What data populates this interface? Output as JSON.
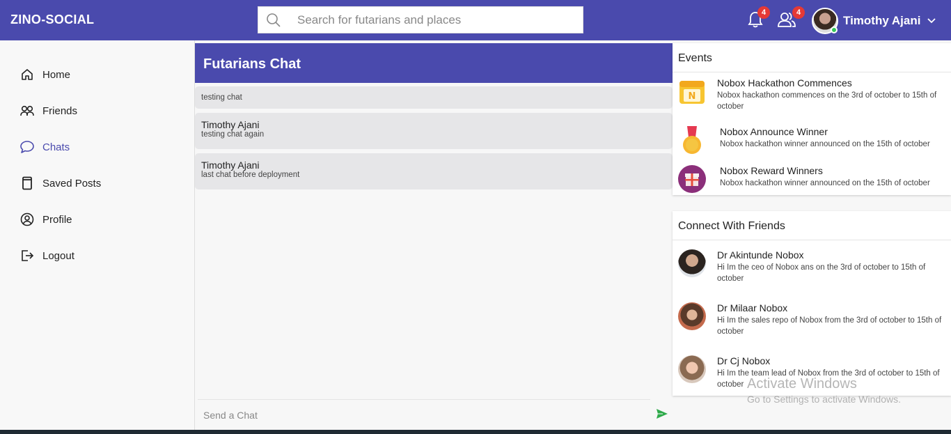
{
  "header": {
    "brand": "ZINO-SOCIAL",
    "search_placeholder": "Search for futarians and places",
    "notifications_count": "4",
    "friend_requests_count": "4",
    "user_name": "Timothy Ajani"
  },
  "sidebar": {
    "items": [
      {
        "label": "Home",
        "icon": "home-icon"
      },
      {
        "label": "Friends",
        "icon": "friends-icon"
      },
      {
        "label": "Chats",
        "icon": "chat-bubble-icon"
      },
      {
        "label": "Saved Posts",
        "icon": "bookmark-icon"
      },
      {
        "label": "Profile",
        "icon": "profile-icon"
      },
      {
        "label": "Logout",
        "icon": "logout-icon"
      }
    ],
    "active": "Chats"
  },
  "chat": {
    "title": "Futarians Chat",
    "messages": [
      {
        "sender": "",
        "text": "testing chat"
      },
      {
        "sender": "Timothy Ajani",
        "text": "testing chat again"
      },
      {
        "sender": "Timothy Ajani",
        "text": "last chat before deployment"
      }
    ],
    "input_placeholder": "Send a Chat"
  },
  "events": {
    "title": "Events",
    "items": [
      {
        "title": "Nobox Hackathon Commences",
        "desc": "Nobox hackathon commences on the 3rd of october to 15th of october"
      },
      {
        "title": "Nobox Announce Winner",
        "desc": "Nobox hackathon winner announced on the 15th of october"
      },
      {
        "title": "Nobox Reward Winners",
        "desc": "Nobox hackathon winner announced on the 15th of october"
      }
    ]
  },
  "friends": {
    "title": "Connect With Friends",
    "items": [
      {
        "name": "Dr Akintunde Nobox",
        "desc": "Hi Im the ceo of Nobox ans on the 3rd of october to 15th of october"
      },
      {
        "name": "Dr Milaar Nobox",
        "desc": "Hi Im the sales repo of Nobox from the 3rd of october to 15th of october"
      },
      {
        "name": "Dr Cj Nobox",
        "desc": "Hi Im the team lead of Nobox from the 3rd of october to 15th of october"
      }
    ]
  },
  "watermark": {
    "line1": "Activate Windows",
    "line2": "Go to Settings to activate Windows."
  },
  "colors": {
    "brand": "#4a4aad",
    "badge": "#e53935",
    "send": "#2eaa4a",
    "online": "#35c65a"
  }
}
